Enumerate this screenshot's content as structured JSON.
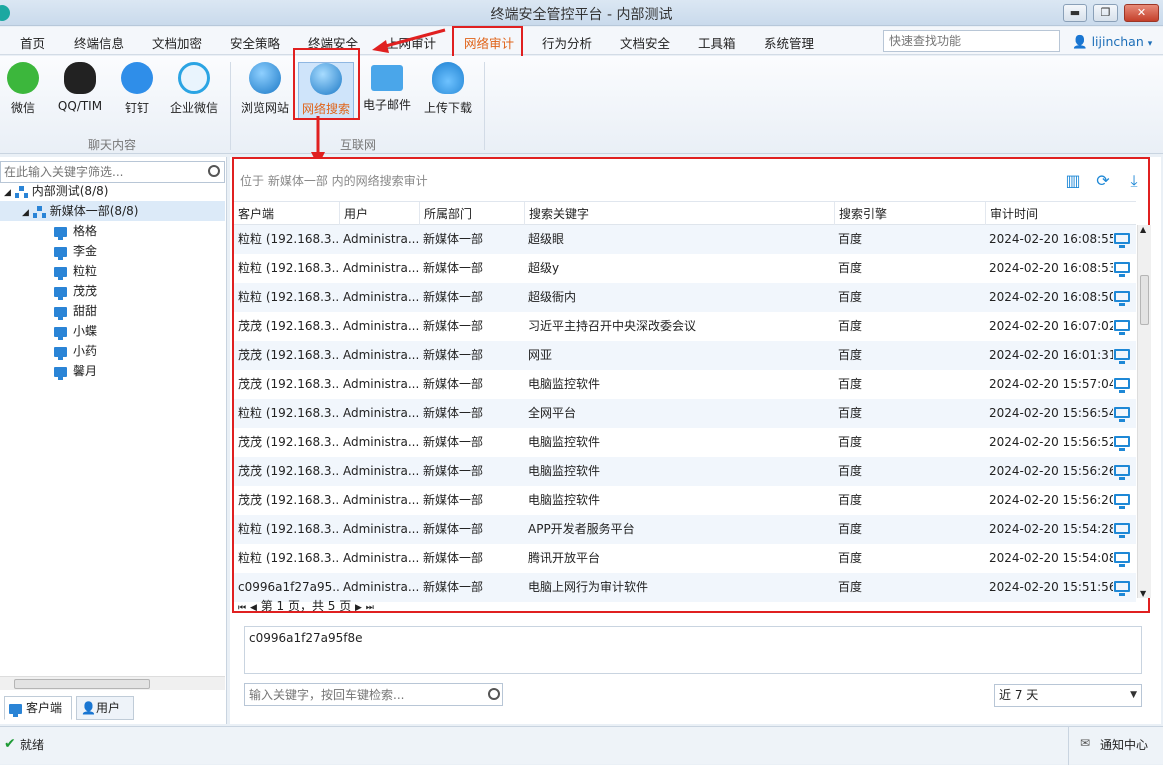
{
  "window": {
    "title": "终端安全管控平台 - 内部测试",
    "buttons": [
      "▬",
      "❐",
      "✕"
    ]
  },
  "menu": {
    "items": [
      "首页",
      "终端信息",
      "文档加密",
      "安全策略",
      "终端安全",
      "上网审计",
      "网络审计",
      "行为分析",
      "文档安全",
      "工具箱",
      "系统管理"
    ],
    "quick_search_placeholder": "快速查找功能",
    "user": "lijinchan"
  },
  "ribbon": {
    "chat_buttons": [
      "微信",
      "QQ/TIM",
      "钉钉",
      "企业微信"
    ],
    "chat_group": "聊天内容",
    "internet_buttons": [
      "浏览网站",
      "网络搜索",
      "电子邮件",
      "上传下载"
    ],
    "internet_group": "互联网"
  },
  "sidebar": {
    "search_placeholder": "在此输入关键字筛选...",
    "root": "内部测试(8/8)",
    "dept": "新媒体一部(8/8)",
    "clients": [
      "格格",
      "李金",
      "粒粒",
      "茂茂",
      "甜甜",
      "小蝶",
      "小药",
      "馨月"
    ],
    "tabs": [
      "客户端",
      "用户"
    ]
  },
  "grid": {
    "location": "位于 新媒体一部 内的网络搜索审计",
    "toolbar_icons": [
      "columns-icon",
      "refresh-icon",
      "download-icon"
    ],
    "columns": [
      "客户端",
      "用户",
      "所属部门",
      "搜索关键字",
      "搜索引擎",
      "审计时间"
    ],
    "rows": [
      [
        "粒粒 (192.168.3...",
        "Administra...",
        "新媒体一部",
        "超级眼",
        "百度",
        "2024-02-20 16:08:55"
      ],
      [
        "粒粒 (192.168.3...",
        "Administra...",
        "新媒体一部",
        "超级y",
        "百度",
        "2024-02-20 16:08:53"
      ],
      [
        "粒粒 (192.168.3...",
        "Administra...",
        "新媒体一部",
        "超级衙内",
        "百度",
        "2024-02-20 16:08:50"
      ],
      [
        "茂茂 (192.168.3...",
        "Administra...",
        "新媒体一部",
        "习近平主持召开中央深改委会议",
        "百度",
        "2024-02-20 16:07:02"
      ],
      [
        "茂茂 (192.168.3...",
        "Administra...",
        "新媒体一部",
        "网亚",
        "百度",
        "2024-02-20 16:01:31"
      ],
      [
        "茂茂 (192.168.3...",
        "Administra...",
        "新媒体一部",
        "电脑监控软件",
        "百度",
        "2024-02-20 15:57:04"
      ],
      [
        "粒粒 (192.168.3...",
        "Administra...",
        "新媒体一部",
        "全网平台",
        "百度",
        "2024-02-20 15:56:54"
      ],
      [
        "茂茂 (192.168.3...",
        "Administra...",
        "新媒体一部",
        "电脑监控软件",
        "百度",
        "2024-02-20 15:56:52"
      ],
      [
        "茂茂 (192.168.3...",
        "Administra...",
        "新媒体一部",
        "电脑监控软件",
        "百度",
        "2024-02-20 15:56:26"
      ],
      [
        "茂茂 (192.168.3...",
        "Administra...",
        "新媒体一部",
        "电脑监控软件",
        "百度",
        "2024-02-20 15:56:20"
      ],
      [
        "粒粒 (192.168.3...",
        "Administra...",
        "新媒体一部",
        "APP开发者服务平台",
        "百度",
        "2024-02-20 15:54:28"
      ],
      [
        "粒粒 (192.168.3...",
        "Administra...",
        "新媒体一部",
        "腾讯开放平台",
        "百度",
        "2024-02-20 15:54:08"
      ],
      [
        "c0996a1f27a95...",
        "Administra...",
        "新媒体一部",
        "电脑上网行为审计软件",
        "百度",
        "2024-02-20 15:51:56"
      ]
    ],
    "pager": "第 1 页，共 5 页"
  },
  "detail": {
    "text": "c0996a1f27a95f8e"
  },
  "filter": {
    "keyword_placeholder": "输入关键字，按回车键检索...",
    "range": "近 7 天"
  },
  "status": {
    "text": "就绪",
    "notify": "通知中心"
  }
}
